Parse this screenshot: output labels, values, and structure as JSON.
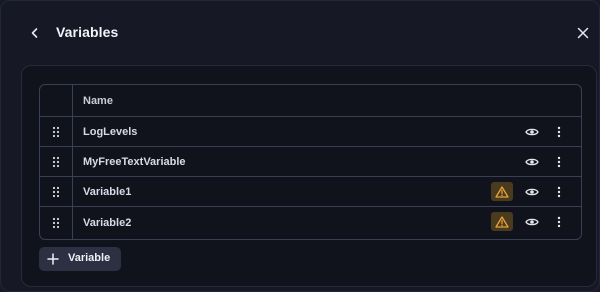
{
  "header": {
    "title": "Variables"
  },
  "table": {
    "column_header": "Name",
    "rows": [
      {
        "name": "LogLevels",
        "warning": false
      },
      {
        "name": "MyFreeTextVariable",
        "warning": false
      },
      {
        "name": "Variable1",
        "warning": true
      },
      {
        "name": "Variable2",
        "warning": true
      }
    ]
  },
  "actions": {
    "add_label": "Variable"
  },
  "icons": {
    "back": "chevron-left-icon",
    "close": "close-icon",
    "drag": "drag-handle-icon",
    "warning": "warning-icon",
    "visibility": "eye-icon",
    "more": "more-vertical-icon",
    "add": "plus-icon"
  },
  "colors": {
    "warning": "#e8a33a",
    "background": "#161925"
  }
}
